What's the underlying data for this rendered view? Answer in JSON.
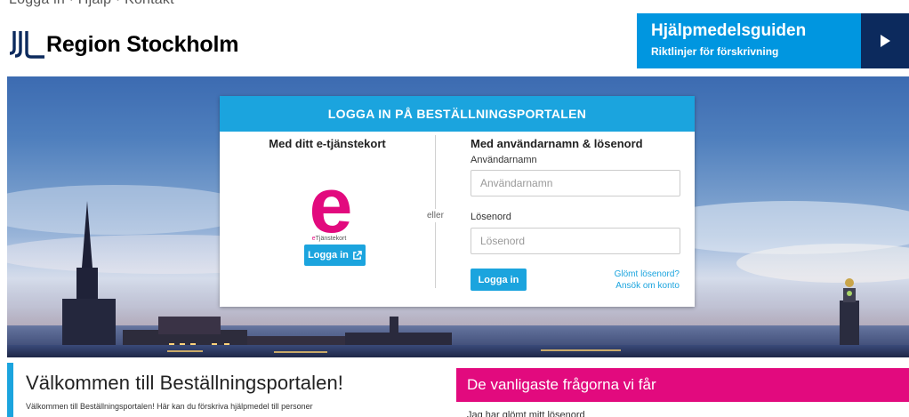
{
  "top_cut": {
    "text": "Logga in  ·  Hjälp  ·  Kontakt"
  },
  "logo": {
    "text": "Region Stockholm"
  },
  "guide": {
    "title": "Hjälpmedelsguiden",
    "subtitle": "Riktlinjer för förskrivning"
  },
  "login": {
    "header": "LOGGA IN PÅ BESTÄLLNINGSPORTALEN",
    "etj": {
      "title": "Med ditt e-tjänstekort",
      "logo_letter": "e",
      "logo_caption_a": "e",
      "logo_caption_b": "Tjänstekort",
      "button": "Logga in"
    },
    "or": "eller",
    "cred": {
      "title": "Med användarnamn & lösenord",
      "username_label": "Användarnamn",
      "username_placeholder": "Användarnamn",
      "password_label": "Lösenord",
      "password_placeholder": "Lösenord",
      "button": "Logga in",
      "forgot": "Glömt lösenord?",
      "apply": "Ansök om konto"
    }
  },
  "welcome": {
    "title": "Välkommen till Beställningsportalen!",
    "text": "Välkommen till Beställningsportalen! Här kan du förskriva hjälpmedel till personer"
  },
  "faq": {
    "title": "De vanligaste frågorna vi får",
    "first_item": "Jag har glömt mitt lösenord"
  },
  "colors": {
    "primary": "#1ba4de",
    "navy": "#0c2a5d",
    "magenta": "#e20a7e",
    "guide": "#0096e0"
  }
}
